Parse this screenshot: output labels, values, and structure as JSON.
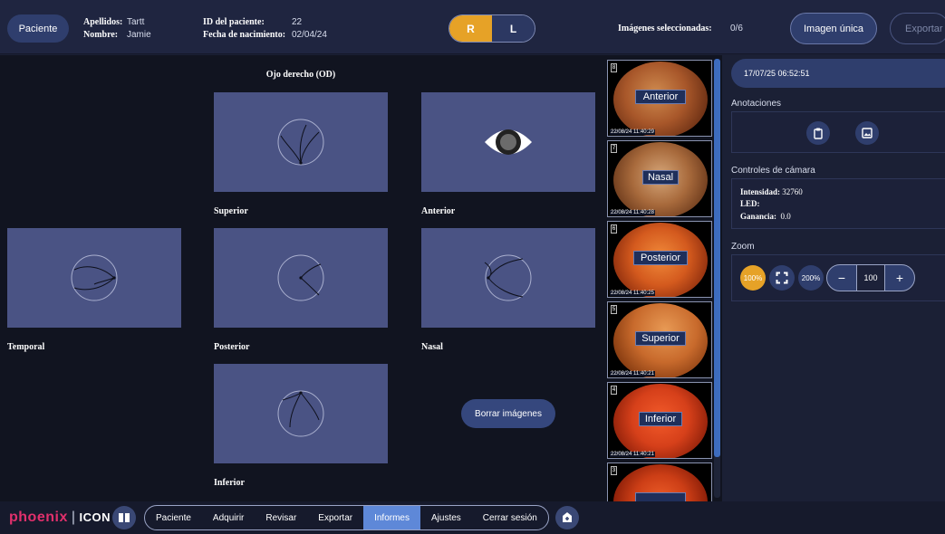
{
  "header": {
    "patient_button": "Paciente",
    "surname_label": "Apellidos:",
    "surname_value": "Tartt",
    "name_label": "Nombre:",
    "name_value": "Jamie",
    "id_label": "ID del paciente:",
    "id_value": "22",
    "dob_label": "Fecha de nacimiento:",
    "dob_value": "02/04/24",
    "eye_right": "R",
    "eye_left": "L",
    "eye_selected": "R",
    "selected_images_label": "Imágenes seleccionadas:",
    "selected_images_value": "0/6",
    "single_image_button": "Imagen única",
    "export_button": "Exportar"
  },
  "workspace": {
    "title": "Ojo derecho (OD)",
    "views": {
      "superior": "Superior",
      "anterior": "Anterior",
      "temporal": "Temporal",
      "posterior": "Posterior",
      "nasal": "Nasal",
      "inferior": "Inferior"
    },
    "clear_button": "Borrar imágenes"
  },
  "thumbnails": [
    {
      "number": "8",
      "label": "Anterior",
      "timestamp": "22/08/24 11:40:29"
    },
    {
      "number": "7",
      "label": "Nasal",
      "timestamp": "22/08/24 11:40:28"
    },
    {
      "number": "6",
      "label": "Posterior",
      "timestamp": "22/08/24 11:40:25"
    },
    {
      "number": "5",
      "label": "Superior",
      "timestamp": "22/08/24 11:40:21"
    },
    {
      "number": "4",
      "label": "Inferior",
      "timestamp": "22/08/24 11:40:21"
    },
    {
      "number": "3",
      "label": "",
      "timestamp": ""
    }
  ],
  "right_panel": {
    "datetime": "17/07/25 06:52:51",
    "annotations_title": "Anotaciones",
    "camera_title": "Controles de cámara",
    "intensity_label": "Intensidad:",
    "intensity_value": "32760",
    "led_label": "LED:",
    "gain_label": "Ganancia:",
    "gain_value": "0.0",
    "zoom_title": "Zoom",
    "zoom_100": "100%",
    "zoom_200": "200%",
    "zoom_value": "100",
    "zoom_minus": "−",
    "zoom_plus": "+"
  },
  "footer": {
    "logo_main": "phoenix",
    "logo_sub": "ICON",
    "nav": [
      "Paciente",
      "Adquirir",
      "Revisar",
      "Exportar",
      "Informes",
      "Ajustes",
      "Cerrar sesión"
    ],
    "active_nav": "Informes"
  },
  "colors": {
    "accent": "#e6a227",
    "panel": "#2f3e6d",
    "active_tab": "#5e88d8",
    "view_box": "#4a5384",
    "brand": "#e1306c"
  }
}
